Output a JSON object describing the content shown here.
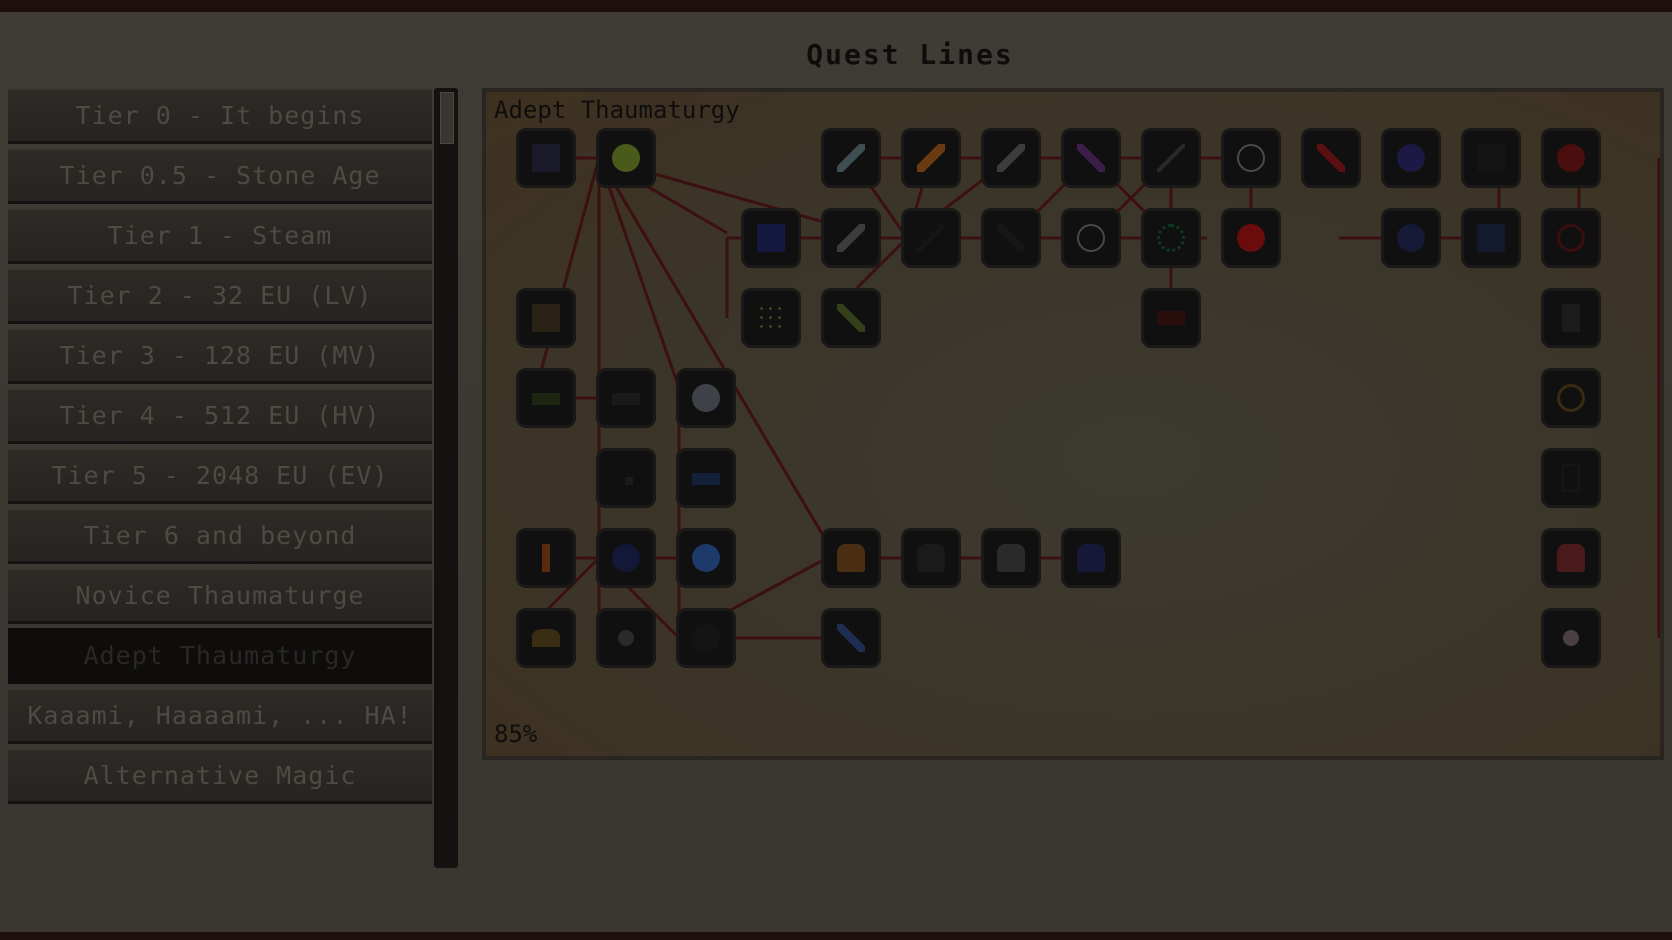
{
  "page_title": "Quest Lines",
  "sidebar": {
    "items": [
      {
        "label": "Tier 0 - It begins"
      },
      {
        "label": "Tier 0.5 - Stone Age"
      },
      {
        "label": "Tier 1 - Steam"
      },
      {
        "label": "Tier 2 - 32 EU (LV)"
      },
      {
        "label": "Tier 3 - 128 EU (MV)"
      },
      {
        "label": "Tier 4 - 512 EU (HV)"
      },
      {
        "label": "Tier 5 - 2048 EU (EV)"
      },
      {
        "label": "Tier 6 and beyond"
      },
      {
        "label": "Novice Thaumaturge"
      },
      {
        "label": "Adept Thaumaturgy"
      },
      {
        "label": "Kaaami, Haaaami, ... HA!"
      },
      {
        "label": "Alternative Magic"
      }
    ],
    "selected_index": 9
  },
  "quest_panel": {
    "title": "Adept Thaumaturgy",
    "zoom": "85%"
  },
  "colors": {
    "background": "#3a3630",
    "panel": "#3b3528",
    "connection_line": "#3c1010",
    "node_fill": "#101010"
  },
  "quests": [
    {
      "id": "q1",
      "icon": "dark-block-icon",
      "color": "#1a1a2a"
    },
    {
      "id": "q2",
      "icon": "flask-icon",
      "color": "#4a5a1a"
    },
    {
      "id": "q3",
      "icon": "blue-dagger-icon",
      "color": "#3e4e52"
    },
    {
      "id": "q4",
      "icon": "orange-rod-icon",
      "color": "#6a3a12"
    },
    {
      "id": "q5",
      "icon": "gray-sword-icon",
      "color": "#3c3c3c"
    },
    {
      "id": "q6",
      "icon": "purple-pickaxe-icon",
      "color": "#3c1e48"
    },
    {
      "id": "q7",
      "icon": "dark-stick-icon",
      "color": "#1e1e1e"
    },
    {
      "id": "q8",
      "icon": "glass-flask-icon",
      "color": "#4a4a4a"
    },
    {
      "id": "q9",
      "icon": "red-wand-icon",
      "color": "#5a1010"
    },
    {
      "id": "q10",
      "icon": "purple-crystal-icon",
      "color": "#1c1a44"
    },
    {
      "id": "q11",
      "icon": "dark-cube-icon",
      "color": "#141414"
    },
    {
      "id": "q12",
      "icon": "red-orb-icon",
      "color": "#4a0e0e"
    },
    {
      "id": "q13",
      "icon": "blue-block-icon",
      "color": "#14183e"
    },
    {
      "id": "q14",
      "icon": "silver-sword-icon",
      "color": "#3c3c3c"
    },
    {
      "id": "q15",
      "icon": "black-stick-icon",
      "color": "#161616"
    },
    {
      "id": "q16",
      "icon": "black-sword-icon",
      "color": "#161616"
    },
    {
      "id": "q17",
      "icon": "potion-bottle-icon",
      "color": "#484848"
    },
    {
      "id": "q18",
      "icon": "green-ring-icon",
      "color": "#0e3a22"
    },
    {
      "id": "q19",
      "icon": "red-sphere-icon",
      "color": "#6a0c0c"
    },
    {
      "id": "q20",
      "icon": "blue-eye-icon",
      "color": "#161a36"
    },
    {
      "id": "q21",
      "icon": "dark-blue-block-icon",
      "color": "#141a2e"
    },
    {
      "id": "q22",
      "icon": "red-amulet-icon",
      "color": "#3a0e0e"
    },
    {
      "id": "q23",
      "icon": "yellow-sparkle-icon",
      "color": "#4a4418"
    },
    {
      "id": "q24",
      "icon": "green-wand-icon",
      "color": "#34401a"
    },
    {
      "id": "q25",
      "icon": "dark-red-pillow-icon",
      "color": "#2a0e0e"
    },
    {
      "id": "q26",
      "icon": "dark-tablet-icon",
      "color": "#1c1c1c"
    },
    {
      "id": "q27",
      "icon": "wooden-box-icon",
      "color": "#2a2214"
    },
    {
      "id": "q28",
      "icon": "green-pedestal-icon",
      "color": "#1e2412"
    },
    {
      "id": "q29",
      "icon": "dark-pedestal-icon",
      "color": "#1a1a1a"
    },
    {
      "id": "q30",
      "icon": "silver-orb-icon",
      "color": "#3e4248"
    },
    {
      "id": "q31",
      "icon": "golden-eye-icon",
      "color": "#3a2a10"
    },
    {
      "id": "q32",
      "icon": "small-rune-icon",
      "color": "#1a1a1a"
    },
    {
      "id": "q33",
      "icon": "blue-slab-icon",
      "color": "#142038"
    },
    {
      "id": "q34",
      "icon": "dark-mirror-icon",
      "color": "#161616"
    },
    {
      "id": "q35",
      "icon": "torch-icon",
      "color": "#5a2a0e"
    },
    {
      "id": "q36",
      "icon": "dark-blue-orb-icon",
      "color": "#141838"
    },
    {
      "id": "q37",
      "icon": "bright-blue-orb-icon",
      "color": "#1e3a6a"
    },
    {
      "id": "q38",
      "icon": "golem-icon",
      "color": "#4a2e14"
    },
    {
      "id": "q39",
      "icon": "dark-golem-icon",
      "color": "#1a1a1a"
    },
    {
      "id": "q40",
      "icon": "stone-golem-icon",
      "color": "#2a2a2a"
    },
    {
      "id": "q41",
      "icon": "blue-golem-icon",
      "color": "#161838"
    },
    {
      "id": "q42",
      "icon": "red-golem-icon",
      "color": "#4a1a1a"
    },
    {
      "id": "q43",
      "icon": "golden-helmet-icon",
      "color": "#3a2e12"
    },
    {
      "id": "q44",
      "icon": "gray-pouch-icon",
      "color": "#2a2a2a"
    },
    {
      "id": "q45",
      "icon": "dark-core-icon",
      "color": "#141414"
    },
    {
      "id": "q46",
      "icon": "blue-syringe-icon",
      "color": "#1e2e52"
    },
    {
      "id": "q47",
      "icon": "white-pearl-icon",
      "color": "#4a4044"
    }
  ]
}
